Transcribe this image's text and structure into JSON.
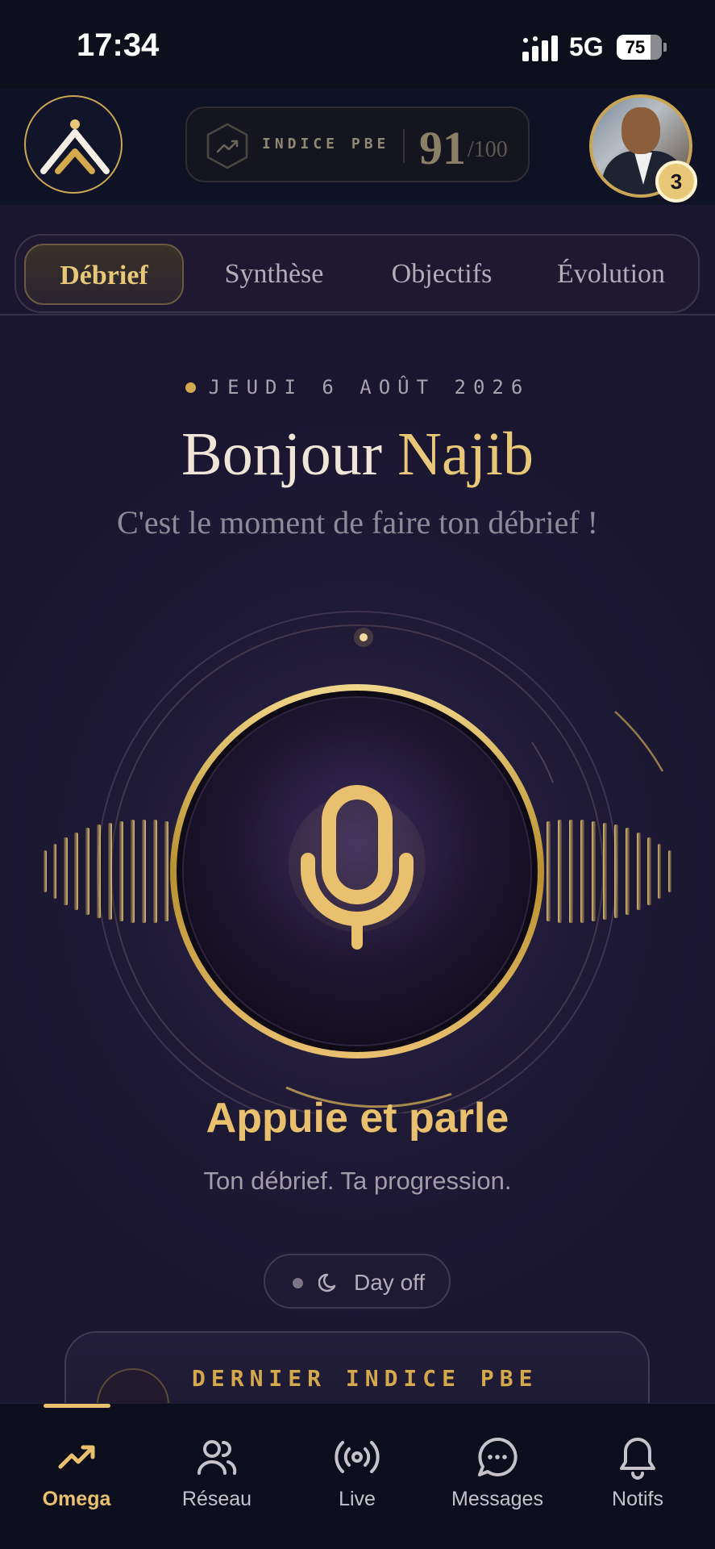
{
  "status_bar": {
    "time": "17:34",
    "network": "5G",
    "battery_percent": "75"
  },
  "header": {
    "logo_icon": "omega-chevron-logo",
    "pbe": {
      "label": "INDICE PBE",
      "score": "91",
      "max": "/100"
    },
    "avatar_notification_count": "3"
  },
  "tabs": [
    {
      "label": "Débrief",
      "active": true
    },
    {
      "label": "Synthèse",
      "active": false
    },
    {
      "label": "Objectifs",
      "active": false
    },
    {
      "label": "Évolution",
      "active": false
    }
  ],
  "greeting": {
    "date": "JEUDI 6 AOÛT 2026",
    "hello": "Bonjour",
    "name": "Najib",
    "subtitle": "C'est le moment de faire ton débrief !"
  },
  "mic": {
    "icon": "microphone-icon",
    "title": "Appuie et parle",
    "tagline": "Ton débrief. Ta progression."
  },
  "day_off": {
    "icon": "moon-icon",
    "label": "Day off"
  },
  "last_card": {
    "title": "DERNIER INDICE PBE"
  },
  "bottom_nav": [
    {
      "label": "Omega",
      "icon": "trending-up-icon",
      "active": true
    },
    {
      "label": "Réseau",
      "icon": "users-icon",
      "active": false
    },
    {
      "label": "Live",
      "icon": "broadcast-icon",
      "active": false
    },
    {
      "label": "Messages",
      "icon": "chat-bubble-icon",
      "active": false
    },
    {
      "label": "Notifs",
      "icon": "bell-icon",
      "active": false
    }
  ],
  "colors": {
    "gold": "#e8c878",
    "gold_dark": "#c9a655",
    "background": "#1c1730",
    "nav_background": "#0c0e1d"
  }
}
